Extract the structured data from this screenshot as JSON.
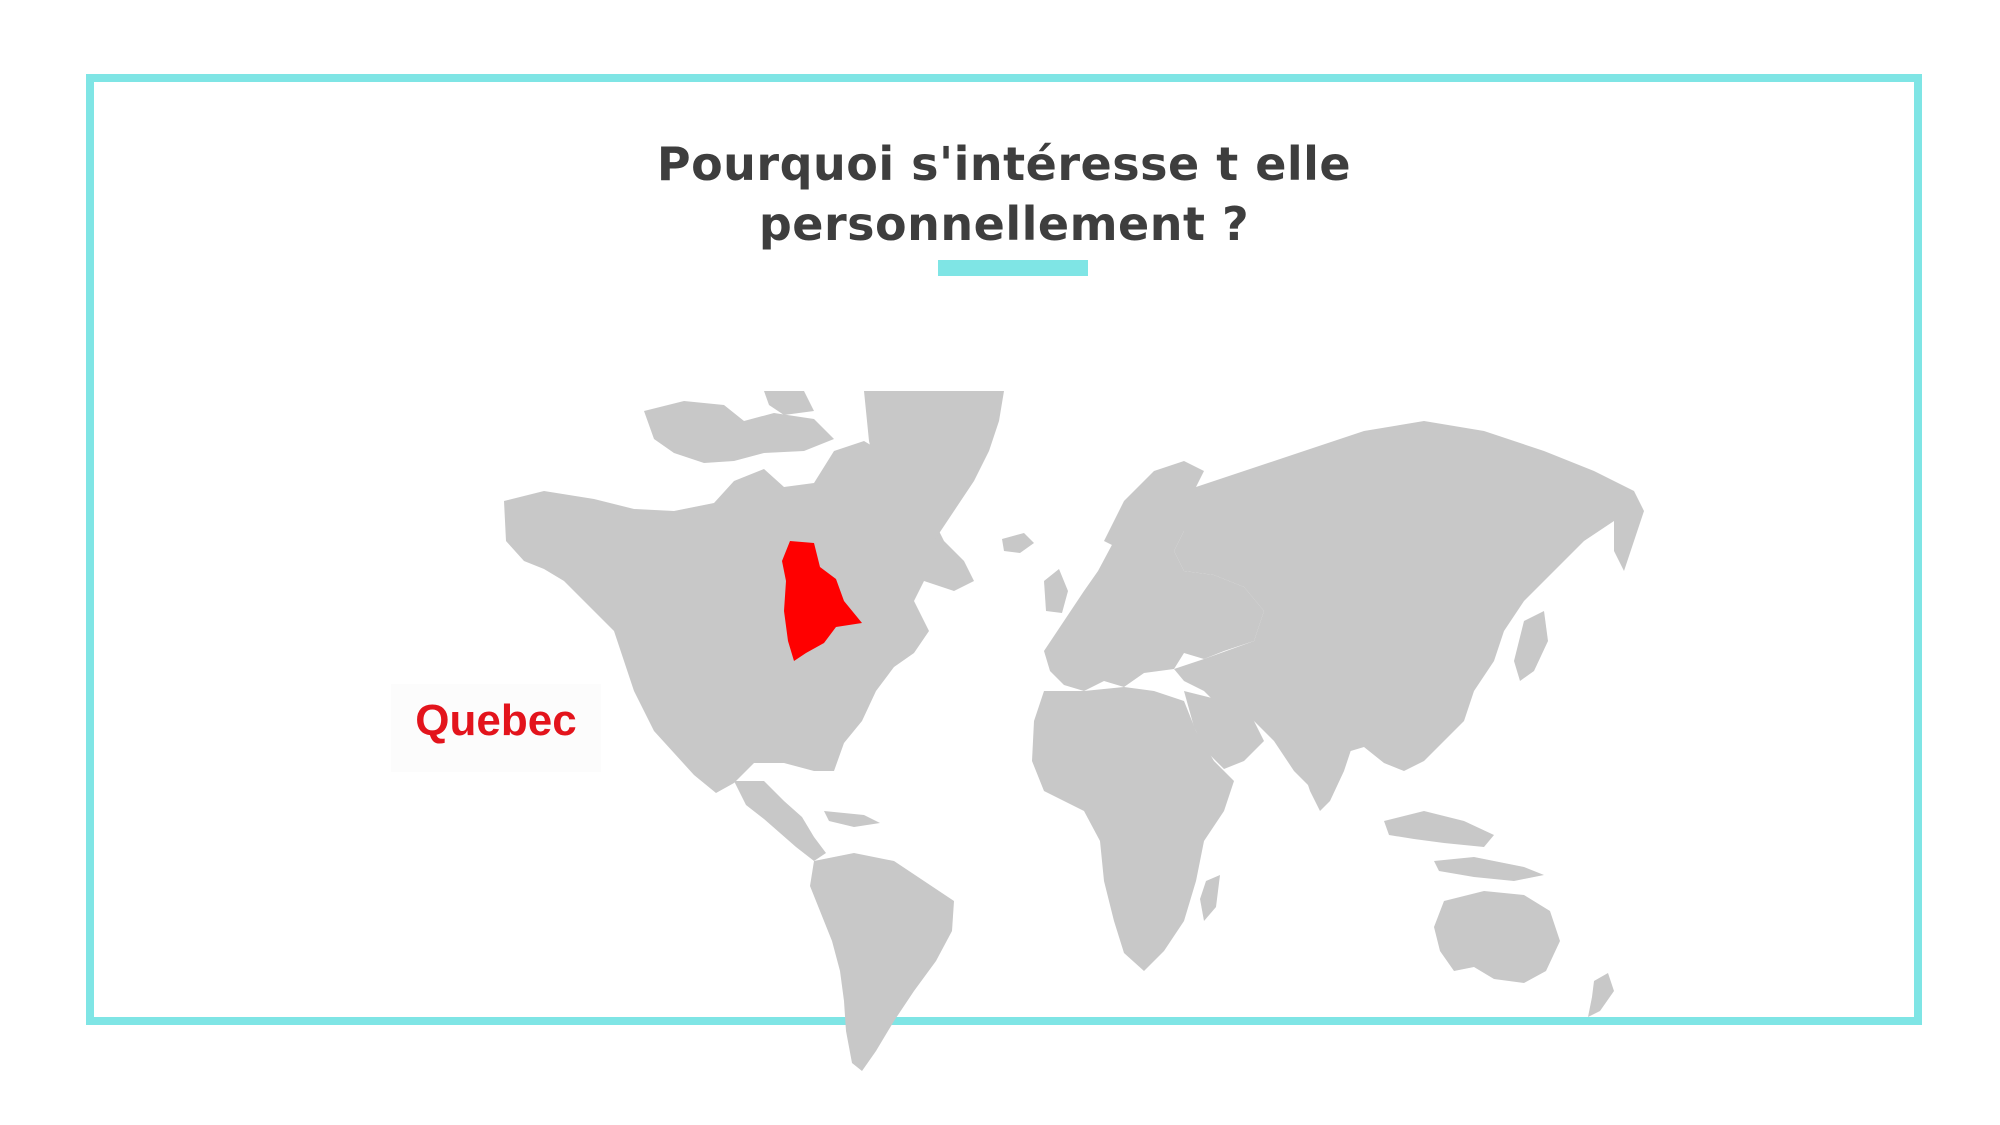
{
  "slide": {
    "title_line1": "Pourquoi s'intéresse t elle",
    "title_line2": "personnellement ?",
    "accent_color": "#7fe5e5",
    "title_color": "#3e3e3e"
  },
  "map": {
    "highlighted_region": "Quebec",
    "label": "Quebec",
    "land_color": "#c8c8c8",
    "highlight_color": "#ff0000",
    "label_color": "#e3141c"
  }
}
